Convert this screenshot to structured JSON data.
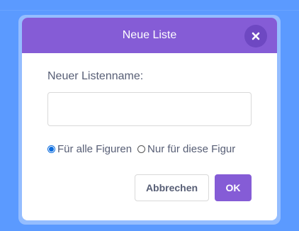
{
  "dialog": {
    "title": "Neue Liste",
    "close_icon": "close-icon",
    "field_label": "Neuer Listenname:",
    "name_value": "",
    "name_placeholder": "",
    "radio_options": [
      {
        "label": "Für alle Figuren",
        "checked": true
      },
      {
        "label": "Nur für diese Figur",
        "checked": false
      }
    ],
    "cancel_label": "Abbrechen",
    "ok_label": "OK"
  },
  "colors": {
    "background": "#5b9aff",
    "header": "#855cd6",
    "close_button": "#6e48c2",
    "ok_button": "#855cd6",
    "text": "#575e75",
    "radio_selected": "#0b6cde"
  }
}
